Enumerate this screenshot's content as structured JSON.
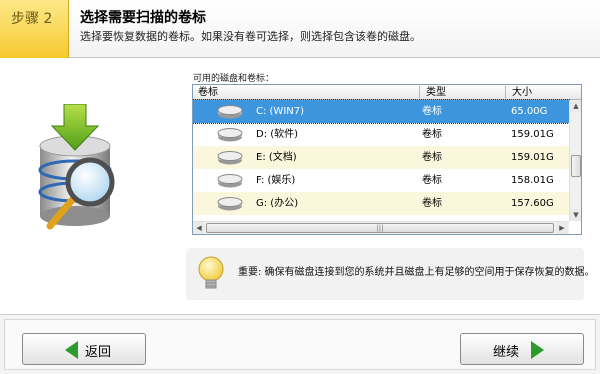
{
  "header": {
    "step_label": "步骤 2",
    "title": "选择需要扫描的卷标",
    "subtitle": "选择要恢复数据的卷标。如果没有卷可选择，则选择包含该卷的磁盘。"
  },
  "volumes": {
    "caption": "可用的磁盘和卷标：",
    "columns": [
      "卷标",
      "类型",
      "大小"
    ],
    "rows": [
      {
        "name": "C: (WIN7)",
        "type": "卷标",
        "size": "65.00G",
        "selected": true
      },
      {
        "name": "D: (软件)",
        "type": "卷标",
        "size": "159.01G",
        "selected": false
      },
      {
        "name": "E: (文档)",
        "type": "卷标",
        "size": "159.01G",
        "selected": false
      },
      {
        "name": "F: (娱乐)",
        "type": "卷标",
        "size": "158.01G",
        "selected": false
      },
      {
        "name": "G: (办公)",
        "type": "卷标",
        "size": "157.60G",
        "selected": false
      }
    ],
    "row_icon": "hard-drive-icon"
  },
  "notice": {
    "icon": "lightbulb-icon",
    "text": "重要: 确保有磁盘连接到您的系统并且磁盘上有足够的空间用于保存恢复的数据。"
  },
  "footer": {
    "back_label": "返回",
    "next_label": "继续"
  },
  "colors": {
    "step_bg": "#f7c92e",
    "selection": "#3d95de",
    "alt_row": "#fbf7dc",
    "arrow_green": "#2d9a2d"
  }
}
